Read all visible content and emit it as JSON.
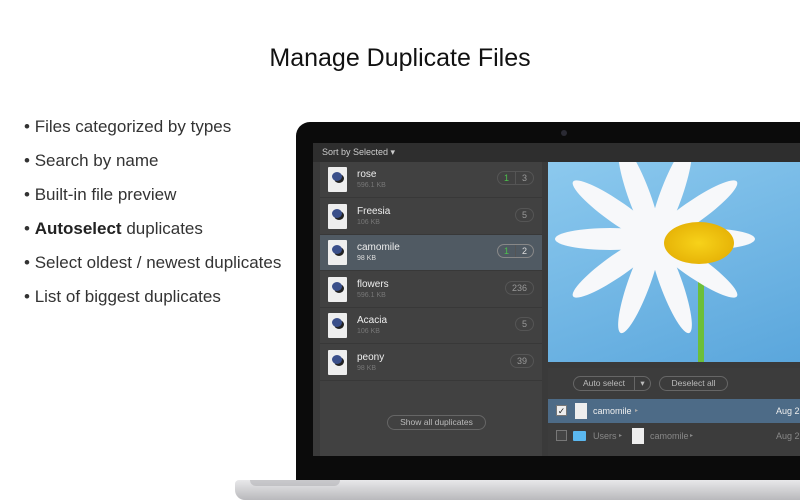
{
  "title": "Manage Duplicate Files",
  "features": [
    {
      "bold": "",
      "text": "Files categorized by types"
    },
    {
      "bold": "",
      "text": "Search by name"
    },
    {
      "bold": "",
      "text": "Built-in file preview"
    },
    {
      "bold": "Autoselect",
      "text": " duplicates"
    },
    {
      "bold": "",
      "text": "Select oldest / newest duplicates"
    },
    {
      "bold": "",
      "text": "List of biggest duplicates"
    }
  ],
  "app": {
    "sort_label": "Sort by Selected ▾",
    "files": [
      {
        "name": "rose",
        "size": "596.1 KB",
        "selected_count": "1",
        "count": "3"
      },
      {
        "name": "Freesia",
        "size": "106 KB",
        "count": "5"
      },
      {
        "name": "camomile",
        "size": "98 KB",
        "selected_count": "1",
        "count": "2"
      },
      {
        "name": "flowers",
        "size": "596.1 KB",
        "count": "236"
      },
      {
        "name": "Acacia",
        "size": "106 KB",
        "count": "5"
      },
      {
        "name": "peony",
        "size": "98 KB",
        "count": "39"
      }
    ],
    "show_all": "Show all duplicates",
    "auto_select": "Auto select",
    "deselect_all": "Deselect all",
    "duplicates": [
      {
        "name": "camomile",
        "date": "Aug 2",
        "checked": true
      },
      {
        "folder": "Users",
        "name": "camomile",
        "date": "Aug 2",
        "checked": false
      }
    ]
  }
}
